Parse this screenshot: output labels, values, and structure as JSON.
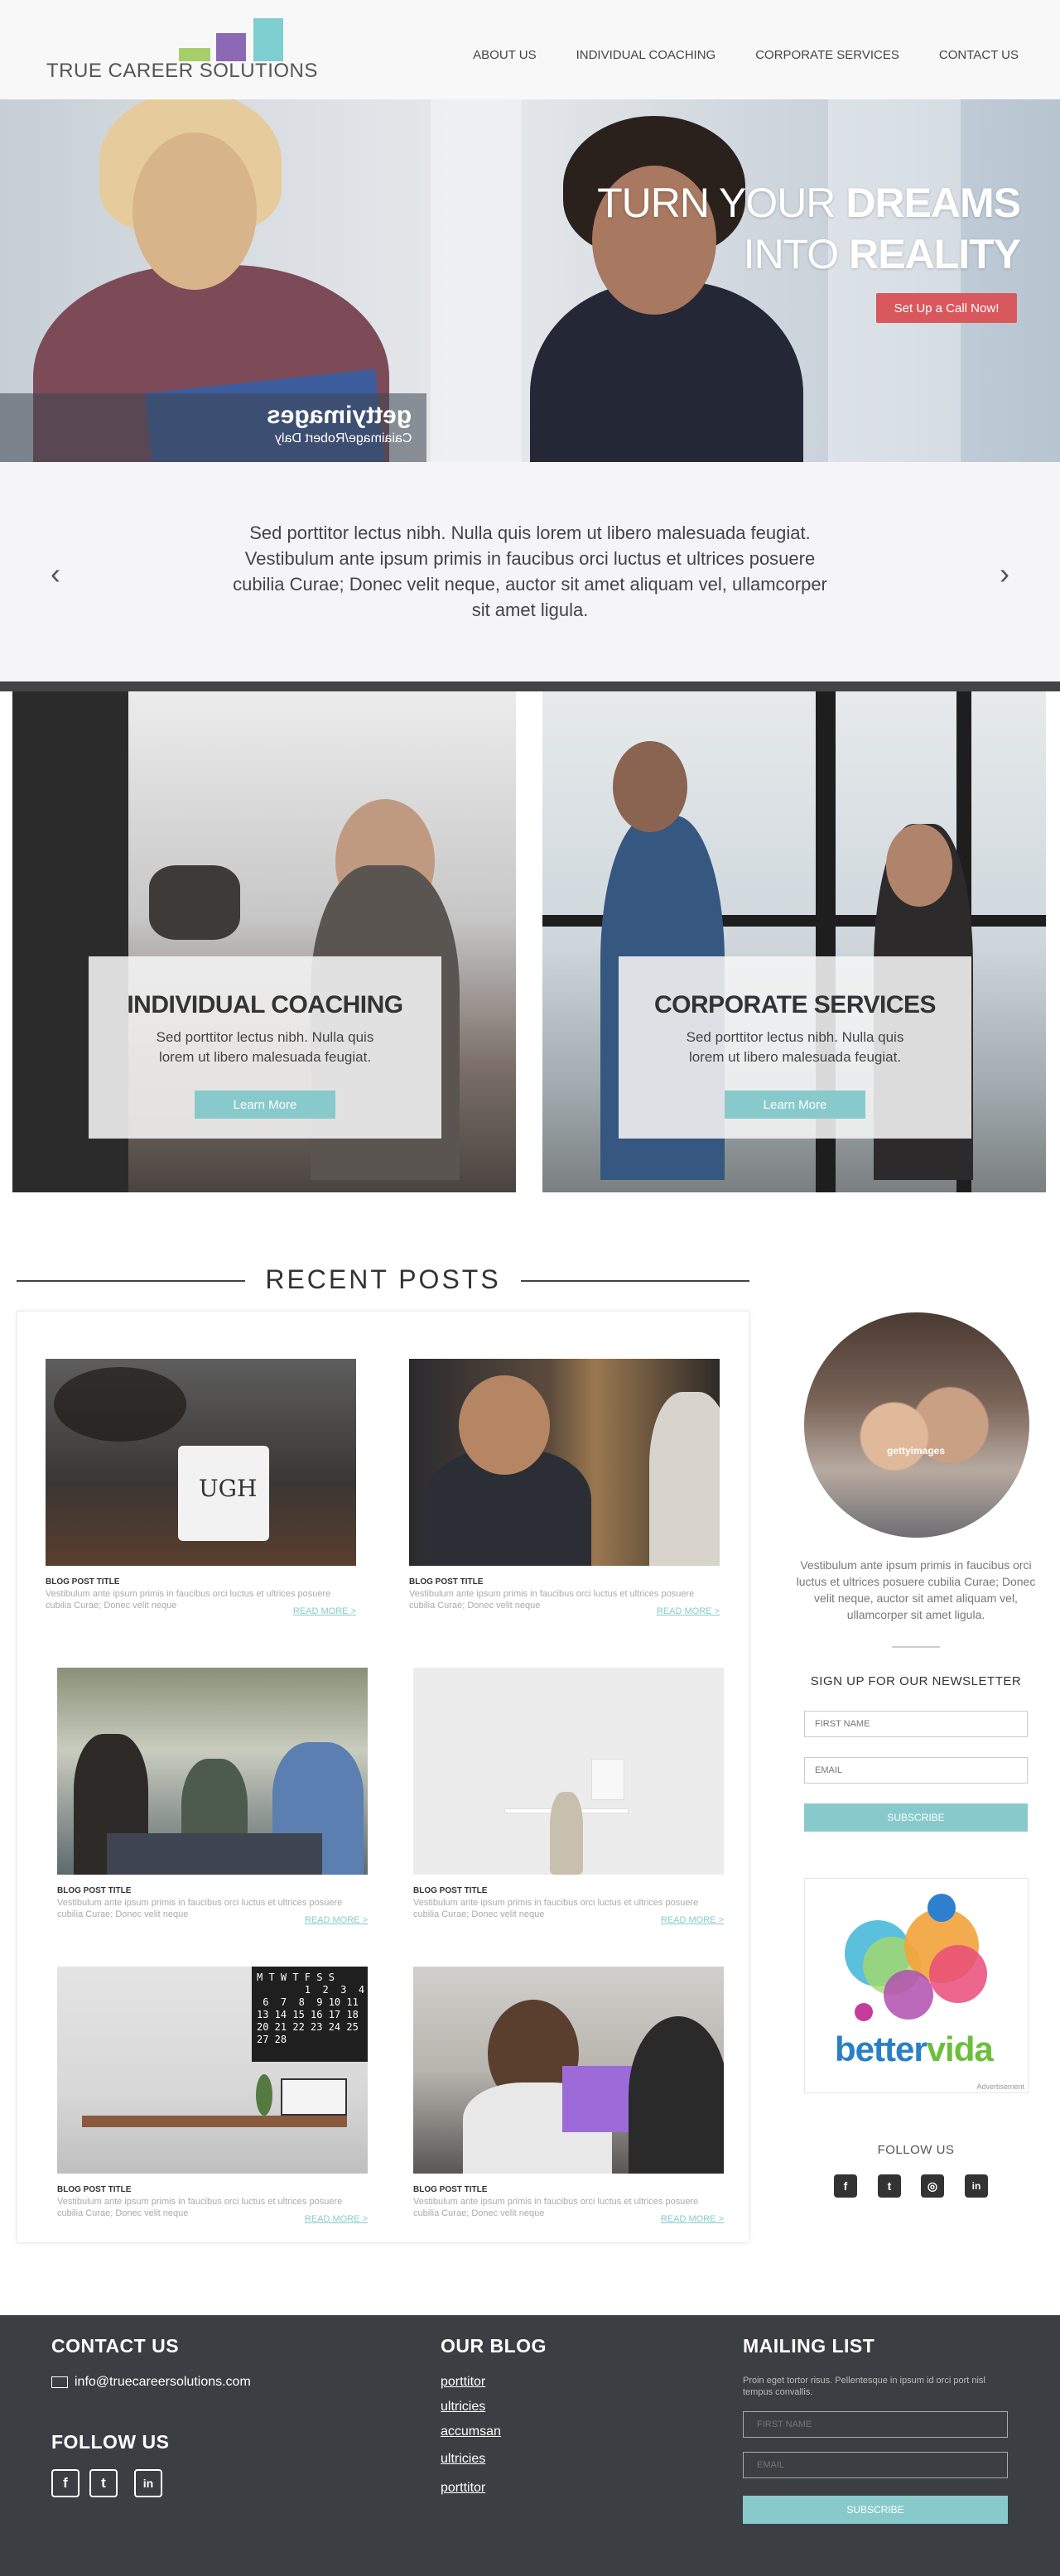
{
  "header": {
    "logo_text": "TRUE CAREER SOLUTIONS",
    "nav": [
      "ABOUT US",
      "INDIVIDUAL COACHING",
      "CORPORATE SERVICES",
      "CONTACT US"
    ]
  },
  "hero": {
    "title_line1_light": "TURN YOUR ",
    "title_line1_bold": "DREAMS",
    "title_line2_light": "INTO ",
    "title_line2_bold": "REALITY",
    "cta": "Set Up a Call Now!",
    "watermark": "gettyimages",
    "watermark_credit": "Caiaimage/Robert Daly"
  },
  "quote": {
    "text": "Sed porttitor lectus nibh. Nulla quis lorem ut libero malesuada feugiat. Vestibulum ante ipsum primis in faucibus orci luctus et ultrices posuere cubilia Curae; Donec velit neque, auctor sit amet aliquam vel, ullamcorper sit amet ligula.",
    "prev": "‹",
    "next": "›"
  },
  "services": [
    {
      "title": "INDIVIDUAL COACHING",
      "text": "Sed porttitor lectus nibh. Nulla quis lorem ut libero malesuada feugiat.",
      "button": "Learn More"
    },
    {
      "title": "CORPORATE SERVICES",
      "text": "Sed porttitor lectus nibh. Nulla quis lorem ut libero malesuada feugiat.",
      "button": "Learn More"
    }
  ],
  "recent_posts": {
    "heading": "RECENT POSTS",
    "posts": [
      {
        "title": "BLOG POST TITLE",
        "excerpt": "Vestibulum ante ipsum primis in faucibus orci luctus et ultrices posuere cubilia Curae; Donec velit neque",
        "more": "READ MORE >"
      },
      {
        "title": "BLOG POST TITLE",
        "excerpt": "Vestibulum ante ipsum primis in faucibus orci luctus et ultrices posuere cubilia Curae; Donec velit neque",
        "more": "READ MORE >"
      },
      {
        "title": "BLOG POST TITLE",
        "excerpt": "Vestibulum ante ipsum primis in faucibus orci luctus et ultrices posuere cubilia Curae; Donec velit neque",
        "more": "READ MORE >"
      },
      {
        "title": "BLOG POST TITLE",
        "excerpt": "Vestibulum ante ipsum primis in faucibus orci luctus et ultrices posuere cubilia Curae; Donec velit neque",
        "more": "READ MORE >"
      },
      {
        "title": "BLOG POST TITLE",
        "excerpt": "Vestibulum ante ipsum primis in faucibus orci luctus et ultrices posuere cubilia Curae; Donec velit neque",
        "more": "READ MORE >"
      },
      {
        "title": "BLOG POST TITLE",
        "excerpt": "Vestibulum ante ipsum primis in faucibus orci luctus et ultrices posuere cubilia Curae; Donec velit neque",
        "more": "READ MORE >"
      }
    ],
    "mug_text": "UGH",
    "calendar_text": "M T W T F S S\n        1  2  3  4\n 6  7  8  9 10 11\n13 14 15 16 17 18\n20 21 22 23 24 25\n27 28"
  },
  "sidebar": {
    "profile_watermark": "gettyimages",
    "about": "Vestibulum ante ipsum primis in faucibus orci luctus et ultrices posuere cubilia Curae; Donec velit neque, auctor sit amet aliquam vel, ullamcorper sit amet ligula.",
    "newsletter_title": "SIGN UP FOR OUR NEWSLETTER",
    "first_name_placeholder": "FIRST NAME",
    "email_placeholder": "EMAIL",
    "subscribe": "SUBSCRIBE",
    "ad_brand_better": "better",
    "ad_brand_vida": "vida",
    "ad_label": "Advertisement",
    "follow": "FOLLOW US",
    "social": [
      "f",
      "t",
      "◎",
      "in"
    ]
  },
  "footer": {
    "contact_heading": "CONTACT US",
    "email": "info@truecareersolutions.com",
    "follow_heading": "FOLLOW US",
    "social": [
      "f",
      "t",
      "in"
    ],
    "blog_heading": "OUR BLOG",
    "blog_links": [
      "porttitor",
      "ultricies",
      "accumsan",
      "ultricies",
      "porttitor"
    ],
    "mailing_heading": "MAILING LIST",
    "mailing_text": "Proin eget tortor risus. Pellentesque in ipsum id orci port nisl tempus convallis.",
    "first_name_placeholder": "FIRST NAME",
    "email_placeholder": "EMAIL",
    "subscribe": "SUBSCRIBE"
  },
  "colors": {
    "accent": "#88cacc",
    "cta": "#d9585e",
    "footer": "#3b3e43",
    "logo_green": "#a6cf6b",
    "logo_purple": "#8c68b5",
    "logo_teal": "#7ecfcf"
  }
}
